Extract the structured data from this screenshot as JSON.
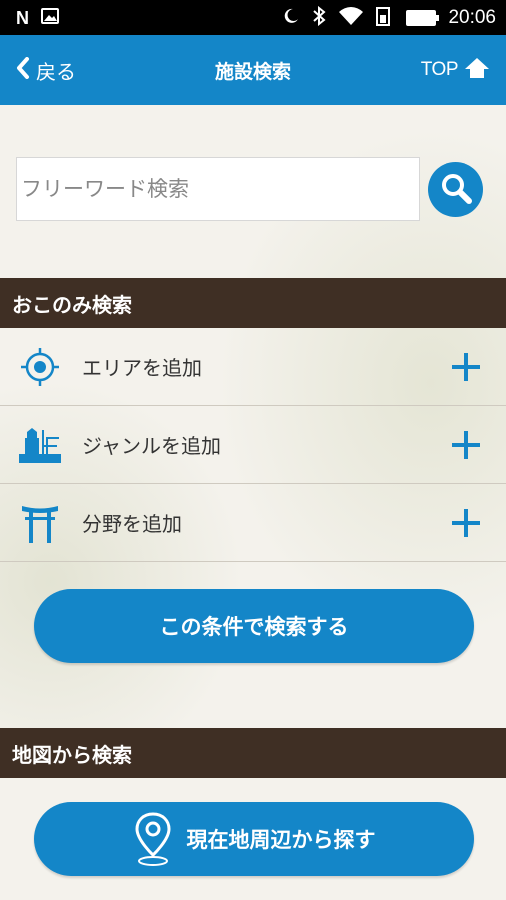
{
  "status_bar": {
    "time": "20:06"
  },
  "header": {
    "back_label": "戻る",
    "title": "施設検索",
    "top_label": "TOP"
  },
  "search": {
    "placeholder": "フリーワード検索"
  },
  "okonomi": {
    "heading": "おこのみ検索",
    "rows": [
      {
        "label": "エリアを追加",
        "icon": "target-icon"
      },
      {
        "label": "ジャンルを追加",
        "icon": "building-icon"
      },
      {
        "label": "分野を追加",
        "icon": "torii-icon"
      }
    ],
    "submit_label": "この条件で検索する"
  },
  "map": {
    "heading": "地図から検索",
    "nearby_label": "現在地周辺から探す"
  },
  "colors": {
    "accent": "#1486c8",
    "section": "#3f2f24",
    "statusbar": "#000000"
  }
}
